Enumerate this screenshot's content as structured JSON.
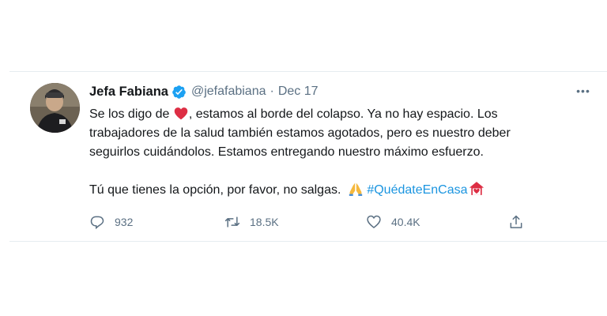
{
  "tweet": {
    "author_name": "Jefa Fabiana",
    "handle": "@jefafabiana",
    "separator": "·",
    "date": "Dec 17",
    "more_label": "•••",
    "lines": [
      {
        "before": "Se los digo de ",
        "emoji": "heart",
        "after": ", estamos al borde del colapso. Ya no hay espacio. Los"
      },
      {
        "text": "trabajadores de la salud también estamos agotados, pero es nuestro deber"
      },
      {
        "text": "seguirlos cuidándolos. Estamos entregando nuestro máximo esfuerzo."
      }
    ],
    "last_line": {
      "text": "Tú que tienes la opción, por favor, no salgas. ",
      "emoji": "folded-hands",
      "hashtag": "#QuédateEnCasa",
      "hashtag_emoji": "house-with-heart"
    },
    "actions": {
      "replies": "932",
      "retweets": "18.5K",
      "likes": "40.4K"
    },
    "colors": {
      "link": "#1b95e0",
      "secondary_text": "#5b7083",
      "verified": "#1da1f2",
      "heart": "#dd2e44",
      "divider": "#e6ecf0"
    }
  }
}
